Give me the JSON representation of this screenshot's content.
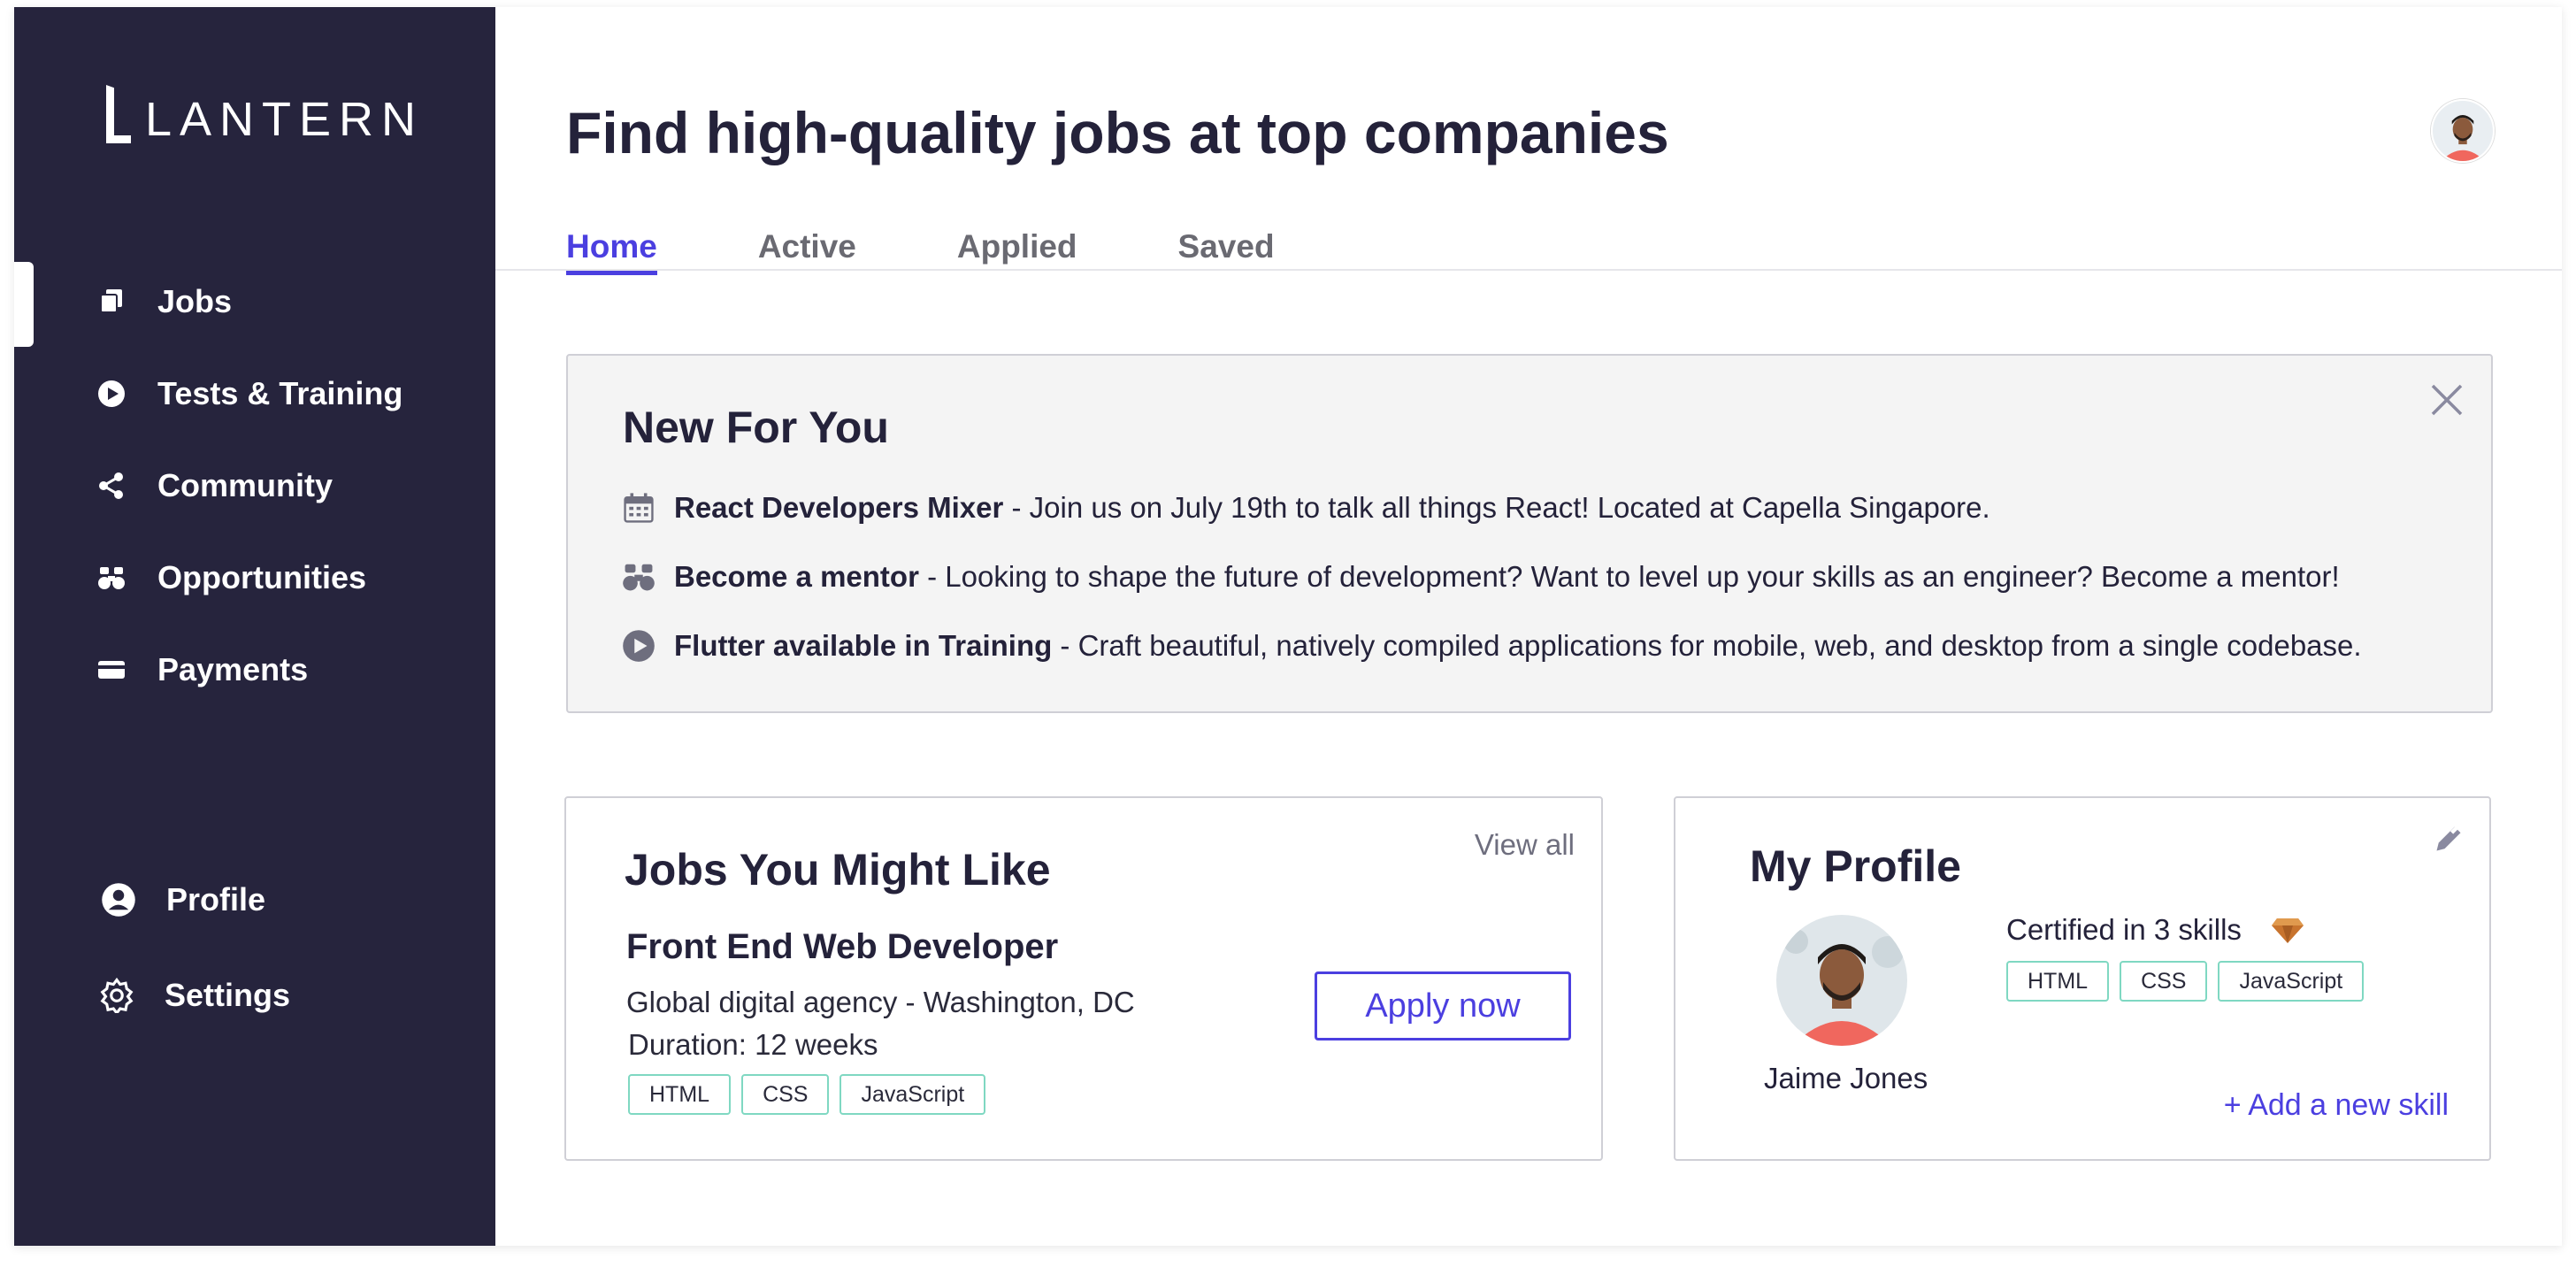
{
  "brand": {
    "name": "LANTERN"
  },
  "sidebar": {
    "items": [
      {
        "label": "Jobs",
        "icon": "jobs-icon"
      },
      {
        "label": "Tests & Training",
        "icon": "play-circle-icon"
      },
      {
        "label": "Community",
        "icon": "share-nodes-icon"
      },
      {
        "label": "Opportunities",
        "icon": "binoculars-icon"
      },
      {
        "label": "Payments",
        "icon": "credit-card-icon"
      }
    ],
    "bottom_items": [
      {
        "label": "Profile",
        "icon": "user-circle-icon"
      },
      {
        "label": "Settings",
        "icon": "gear-icon"
      }
    ],
    "active": "Jobs"
  },
  "header": {
    "title": "Find high-quality jobs at top companies",
    "tabs": [
      {
        "label": "Home",
        "active": true
      },
      {
        "label": "Active",
        "active": false
      },
      {
        "label": "Applied",
        "active": false
      },
      {
        "label": "Saved",
        "active": false
      }
    ]
  },
  "new_for_you": {
    "title": "New For You",
    "items": [
      {
        "icon": "calendar-icon",
        "headline": "React Developers Mixer",
        "text": " - Join us on July 19th to talk all things React! Located at Capella Singapore."
      },
      {
        "icon": "binoculars-icon",
        "headline": "Become a mentor",
        "text": " - Looking to shape the future of development? Want to level up your skills as an engineer? Become a mentor!"
      },
      {
        "icon": "play-circle-icon",
        "headline": "Flutter available in Training",
        "text": " - Craft beautiful, natively compiled applications for mobile, web, and desktop from a single codebase."
      }
    ]
  },
  "jobs_card": {
    "title": "Jobs You Might Like",
    "view_all": "View all",
    "job": {
      "title": "Front End Web Developer",
      "company_location": "Global digital agency - Washington, DC",
      "duration": "Duration: 12 weeks",
      "skills": [
        "HTML",
        "CSS",
        "JavaScript"
      ],
      "apply_label": "Apply now"
    }
  },
  "profile_card": {
    "title": "My Profile",
    "name": "Jaime Jones",
    "certified": "Certified in 3 skills",
    "skills": [
      "HTML",
      "CSS",
      "JavaScript"
    ],
    "add_skill": "+ Add a new skill"
  },
  "colors": {
    "sidebar_bg": "#26243d",
    "accent": "#4b3fe0",
    "chip_border": "#7fd8c2",
    "panel_bg": "#f4f4f4"
  }
}
